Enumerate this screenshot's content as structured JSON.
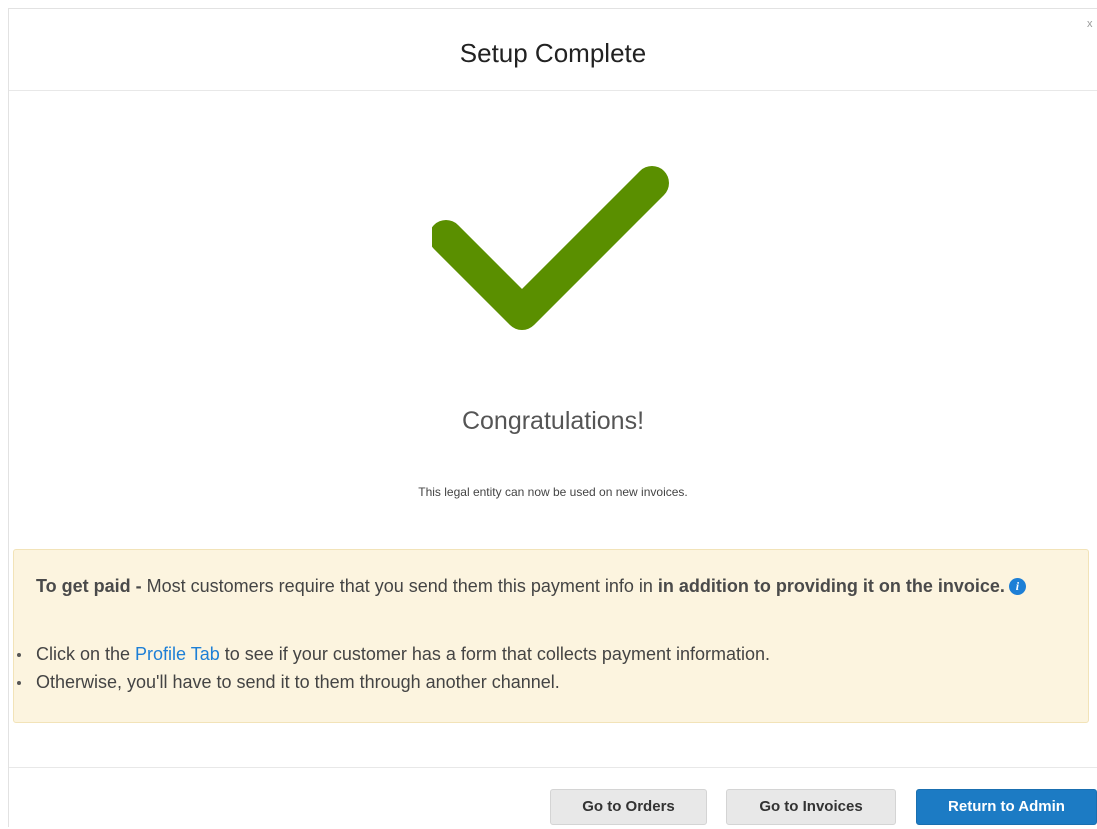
{
  "dialog": {
    "title": "Setup Complete",
    "close_label": "x"
  },
  "success": {
    "icon": "checkmark-icon",
    "icon_color": "#5a8f00",
    "heading": "Congratulations!",
    "message": "This legal entity can now be used on new invoices."
  },
  "notice": {
    "lead_bold": "To get paid -",
    "lead_text": " Most customers require that you send them this payment info in ",
    "lead_bold_end": "in addition to providing it on the invoice.",
    "info_icon": "info-icon",
    "bullet1_before": "Click on the ",
    "bullet1_link": "Profile Tab",
    "bullet1_after": " to see if your customer has a form that collects payment information.",
    "bullet2": "Otherwise, you'll have to send it to them through another channel.",
    "background": "#fcf4df"
  },
  "footer": {
    "go_to_orders": "Go to Orders",
    "go_to_invoices": "Go to Invoices",
    "return_to_admin": "Return to Admin",
    "primary_color": "#1c7bc4"
  }
}
